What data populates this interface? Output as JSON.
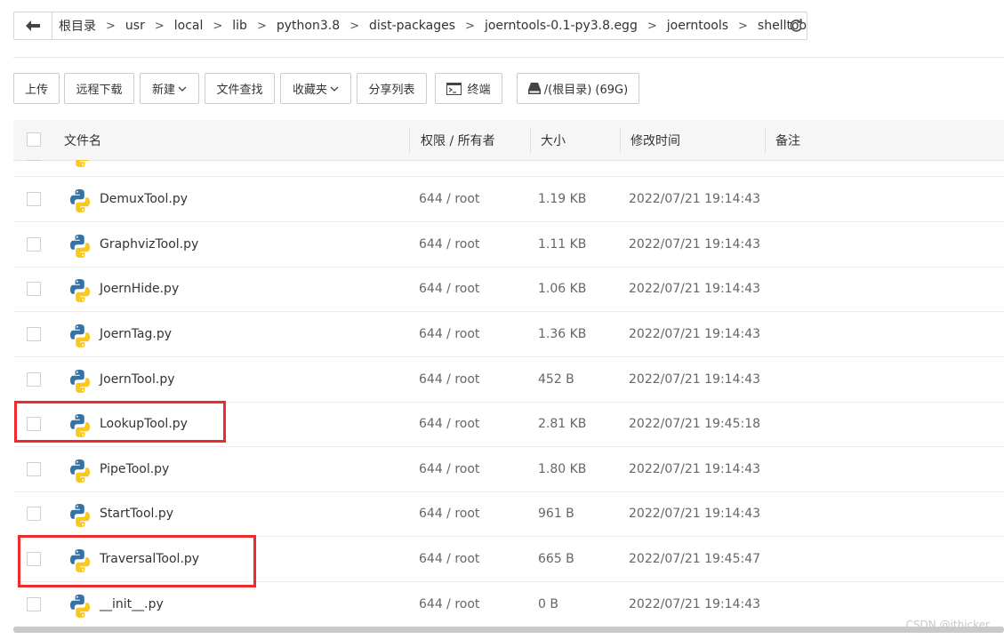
{
  "breadcrumb": {
    "items": [
      "根目录",
      "usr",
      "local",
      "lib",
      "python3.8",
      "dist-packages",
      "joerntools-0.1-py3.8.egg",
      "joerntools",
      "shelltool"
    ],
    "separator": ">"
  },
  "toolbar": {
    "upload": "上传",
    "remote_download": "远程下载",
    "new": "新建",
    "file_search": "文件查找",
    "favorites": "收藏夹",
    "share_list": "分享列表",
    "terminal": "终端",
    "disk": "/(根目录) (69G)"
  },
  "table": {
    "columns": [
      "文件名",
      "权限 / 所有者",
      "大小",
      "修改时间",
      "备注"
    ],
    "rows": [
      {
        "name": "DemuxTool.py",
        "perm": "644 / root",
        "size": "1.19 KB",
        "time": "2022/07/21 19:14:43"
      },
      {
        "name": "GraphvizTool.py",
        "perm": "644 / root",
        "size": "1.11 KB",
        "time": "2022/07/21 19:14:43"
      },
      {
        "name": "JoernHide.py",
        "perm": "644 / root",
        "size": "1.06 KB",
        "time": "2022/07/21 19:14:43"
      },
      {
        "name": "JoernTag.py",
        "perm": "644 / root",
        "size": "1.36 KB",
        "time": "2022/07/21 19:14:43"
      },
      {
        "name": "JoernTool.py",
        "perm": "644 / root",
        "size": "452 B",
        "time": "2022/07/21 19:14:43"
      },
      {
        "name": "LookupTool.py",
        "perm": "644 / root",
        "size": "2.81 KB",
        "time": "2022/07/21 19:45:18"
      },
      {
        "name": "PipeTool.py",
        "perm": "644 / root",
        "size": "1.80 KB",
        "time": "2022/07/21 19:14:43"
      },
      {
        "name": "StartTool.py",
        "perm": "644 / root",
        "size": "961 B",
        "time": "2022/07/21 19:14:43"
      },
      {
        "name": "TraversalTool.py",
        "perm": "644 / root",
        "size": "665 B",
        "time": "2022/07/21 19:45:47"
      },
      {
        "name": "__init__.py",
        "perm": "644 / root",
        "size": "0 B",
        "time": "2022/07/21 19:14:43"
      }
    ]
  },
  "watermark": "CSDN @ithicker",
  "colors": {
    "highlight": "#ee2b2b",
    "python_blue": "#3572a5",
    "python_yellow": "#f7c920"
  }
}
